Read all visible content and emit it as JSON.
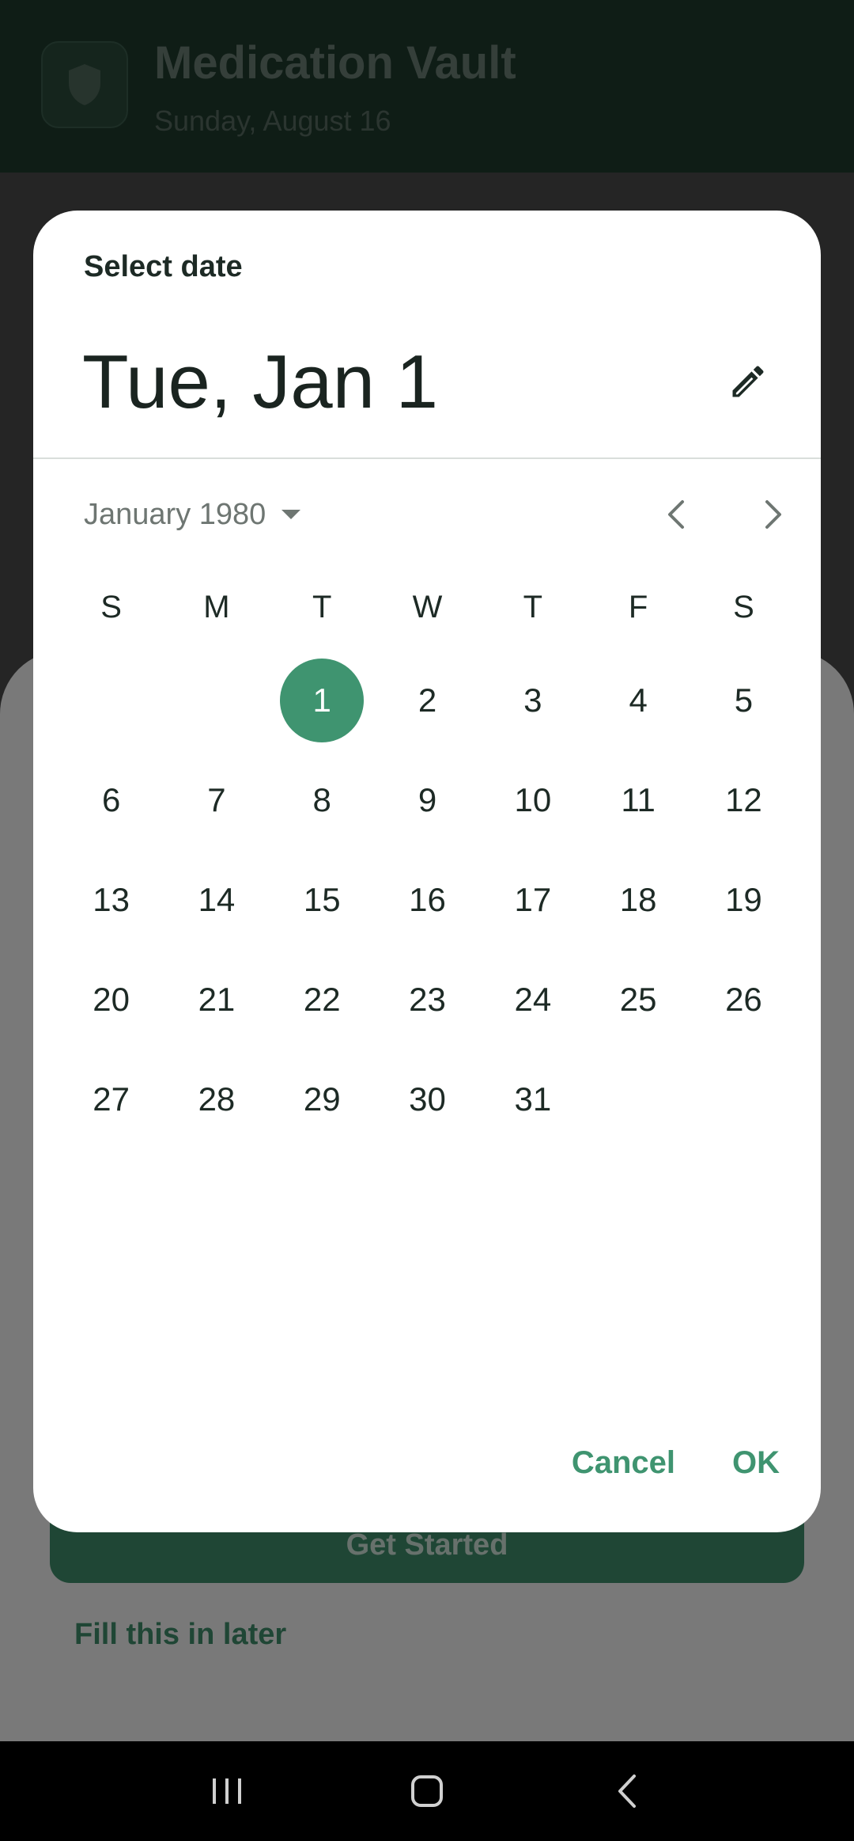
{
  "app": {
    "title": "Medication Vault",
    "date": "Sunday, August 16",
    "get_started_label": "Get Started",
    "fill_later_label": "Fill this in later"
  },
  "dialog": {
    "headline": "Select date",
    "selected_date": "Tue, Jan 1",
    "month_year": "January 1980",
    "weekdays": [
      "S",
      "M",
      "T",
      "W",
      "T",
      "F",
      "S"
    ],
    "weeks": [
      [
        "",
        "",
        "1",
        "2",
        "3",
        "4",
        "5"
      ],
      [
        "6",
        "7",
        "8",
        "9",
        "10",
        "11",
        "12"
      ],
      [
        "13",
        "14",
        "15",
        "16",
        "17",
        "18",
        "19"
      ],
      [
        "20",
        "21",
        "22",
        "23",
        "24",
        "25",
        "26"
      ],
      [
        "27",
        "28",
        "29",
        "30",
        "31",
        "",
        ""
      ]
    ],
    "selected_day": "1",
    "cancel_label": "Cancel",
    "ok_label": "OK"
  },
  "icons": {
    "app_logo": "shield-icon",
    "edit": "pencil-icon",
    "month_dropdown": "caret-down-icon",
    "prev_month": "chevron-left-icon",
    "next_month": "chevron-right-icon",
    "nav_recents": "recents-icon",
    "nav_home": "home-icon",
    "nav_back": "back-icon"
  },
  "colors": {
    "accent": "#3f9470",
    "header": "#1f3a2d",
    "text": "#1d2a25"
  }
}
